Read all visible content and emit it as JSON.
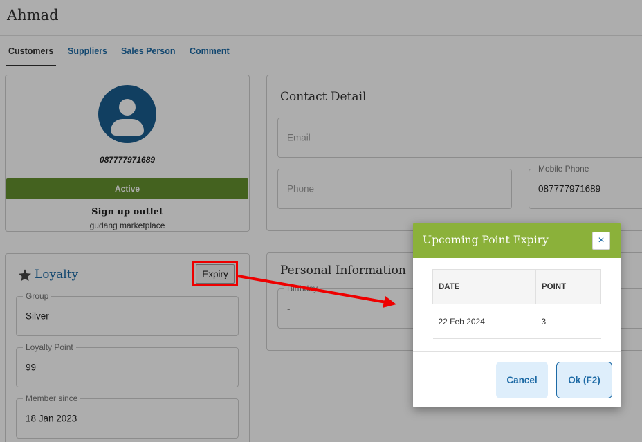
{
  "page": {
    "title": "Ahmad"
  },
  "tabs": [
    {
      "label": "Customers",
      "active": true
    },
    {
      "label": "Suppliers"
    },
    {
      "label": "Sales Person"
    },
    {
      "label": "Comment"
    }
  ],
  "profile": {
    "phone": "087777971689",
    "status": "Active",
    "signup_title": "Sign up outlet",
    "signup_outlet": "gudang marketplace"
  },
  "contact": {
    "title": "Contact Detail",
    "email_placeholder": "Email",
    "phone_placeholder": "Phone",
    "mobile_label": "Mobile Phone",
    "mobile_value": "087777971689"
  },
  "personal": {
    "title": "Personal Information",
    "birthday_label": "Birthday",
    "birthday_value": "-"
  },
  "loyalty": {
    "title": "Loyalty",
    "expiry_button": "Expiry",
    "group_label": "Group",
    "group_value": "Silver",
    "points_label": "Loyalty Point",
    "points_value": "99",
    "member_since_label": "Member since",
    "member_since_value": "18 Jan 2023"
  },
  "modal": {
    "title": "Upcoming Point Expiry",
    "close_icon": "×",
    "columns": [
      "DATE",
      "POINT"
    ],
    "rows": [
      {
        "date": "22 Feb 2024",
        "point": "3"
      }
    ],
    "cancel_label": "Cancel",
    "ok_label": "Ok (F2)"
  },
  "colors": {
    "primary_blue": "#1d6aa5",
    "status_green": "#65912e",
    "modal_header_green": "#8bb13a",
    "annotation_red": "#ee0000"
  }
}
